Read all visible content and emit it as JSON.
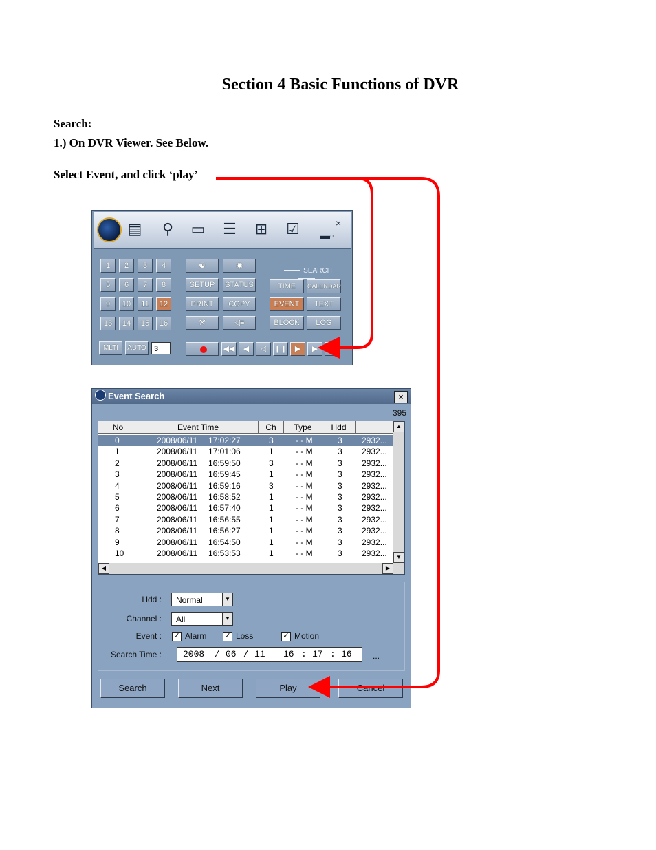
{
  "document": {
    "title": "Section 4 Basic Functions of DVR",
    "search_heading": "Search:",
    "step_1": "1.) On DVR Viewer. See Below.",
    "instruction": "Select Event, and click ‘play’"
  },
  "viewer": {
    "channel_buttons": [
      "1",
      "2",
      "3",
      "4",
      "5",
      "6",
      "7",
      "8",
      "9",
      "10",
      "11",
      "12",
      "13",
      "14",
      "15",
      "16"
    ],
    "active_channel": "12",
    "function_buttons": {
      "setup": "SETUP",
      "status": "STATUS",
      "print": "PRINT",
      "copy": "COPY"
    },
    "search_label": "SEARCH",
    "search_buttons": {
      "time": "TIME",
      "calendar": "CALENDAR",
      "event": "EVENT",
      "text": "TEXT",
      "block": "BLOCK",
      "log": "LOG"
    },
    "multi_label": "MLTI",
    "auto_label": "AUTO",
    "auto_value": "3",
    "window_controls": {
      "minimize": "–",
      "close": "×"
    }
  },
  "event_search": {
    "title": "Event Search",
    "close_glyph": "×",
    "count": "395",
    "columns": [
      "No",
      "Event Time",
      "Ch",
      "Type",
      "Hdd",
      ""
    ],
    "rows": [
      {
        "no": "0",
        "date": "2008/06/11",
        "time": "17:02:27",
        "ch": "3",
        "type": "- - M",
        "hdd": "3",
        "pos": "2932..."
      },
      {
        "no": "1",
        "date": "2008/06/11",
        "time": "17:01:06",
        "ch": "1",
        "type": "- - M",
        "hdd": "3",
        "pos": "2932..."
      },
      {
        "no": "2",
        "date": "2008/06/11",
        "time": "16:59:50",
        "ch": "3",
        "type": "- - M",
        "hdd": "3",
        "pos": "2932..."
      },
      {
        "no": "3",
        "date": "2008/06/11",
        "time": "16:59:45",
        "ch": "1",
        "type": "- - M",
        "hdd": "3",
        "pos": "2932..."
      },
      {
        "no": "4",
        "date": "2008/06/11",
        "time": "16:59:16",
        "ch": "3",
        "type": "- - M",
        "hdd": "3",
        "pos": "2932..."
      },
      {
        "no": "5",
        "date": "2008/06/11",
        "time": "16:58:52",
        "ch": "1",
        "type": "- - M",
        "hdd": "3",
        "pos": "2932..."
      },
      {
        "no": "6",
        "date": "2008/06/11",
        "time": "16:57:40",
        "ch": "1",
        "type": "- - M",
        "hdd": "3",
        "pos": "2932..."
      },
      {
        "no": "7",
        "date": "2008/06/11",
        "time": "16:56:55",
        "ch": "1",
        "type": "- - M",
        "hdd": "3",
        "pos": "2932..."
      },
      {
        "no": "8",
        "date": "2008/06/11",
        "time": "16:56:27",
        "ch": "1",
        "type": "- - M",
        "hdd": "3",
        "pos": "2932..."
      },
      {
        "no": "9",
        "date": "2008/06/11",
        "time": "16:54:50",
        "ch": "1",
        "type": "- - M",
        "hdd": "3",
        "pos": "2932..."
      },
      {
        "no": "10",
        "date": "2008/06/11",
        "time": "16:53:53",
        "ch": "1",
        "type": "- - M",
        "hdd": "3",
        "pos": "2932..."
      }
    ],
    "selected_row": "0",
    "hdd_label": "Hdd :",
    "hdd_value": "Normal",
    "channel_label": "Channel :",
    "channel_value": "All",
    "event_label": "Event :",
    "event_options": [
      {
        "label": "Alarm",
        "checked": true
      },
      {
        "label": "Loss",
        "checked": true
      },
      {
        "label": "Motion",
        "checked": true
      }
    ],
    "search_time_label": "Search Time :",
    "search_time": {
      "year": "2008",
      "month": "06",
      "day": "11",
      "hour": "16",
      "minute": "17",
      "second": "16"
    },
    "more_glyph": "...",
    "buttons": {
      "search": "Search",
      "next": "Next",
      "play": "Play",
      "cancel": "Cancel"
    }
  },
  "annotation_color": "#ff0000"
}
